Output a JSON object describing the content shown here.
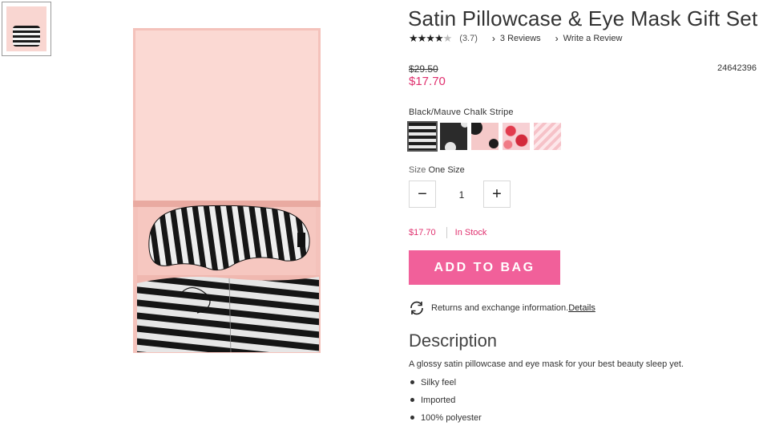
{
  "product": {
    "title": "Satin Pillowcase & Eye Mask Gift Set",
    "rating_value": "(3.7)",
    "reviews_link": "3 Reviews",
    "write_review_link": "Write a Review",
    "original_price": "$29.50",
    "sale_price": "$17.70",
    "sku": "24642396",
    "selected_color": "Black/Mauve Chalk Stripe",
    "swatches": [
      "Black/Mauve Chalk Stripe",
      "Black Dot",
      "Pink Black Dot",
      "Red Floral",
      "Pink Stripe"
    ],
    "size_label": "Size",
    "size_value": "One Size",
    "quantity": "1",
    "stock_price": "$17.70",
    "stock_status": "In Stock",
    "add_to_bag": "ADD TO BAG",
    "returns_text": "Returns and exchange information.",
    "returns_link": "Details",
    "description_title": "Description",
    "description_text": "A glossy satin pillowcase and eye mask for your best beauty sleep yet.",
    "bullets": [
      "Silky feel",
      "Imported",
      "100% polyester"
    ]
  },
  "colors": {
    "accent_pink": "#f1609a",
    "price_pink": "#e0316f"
  },
  "icons": {
    "rating": "star-icon",
    "link_arrow": "chevron-right-icon",
    "returns": "refresh-icon",
    "minus": "minus-icon",
    "plus": "plus-icon"
  }
}
